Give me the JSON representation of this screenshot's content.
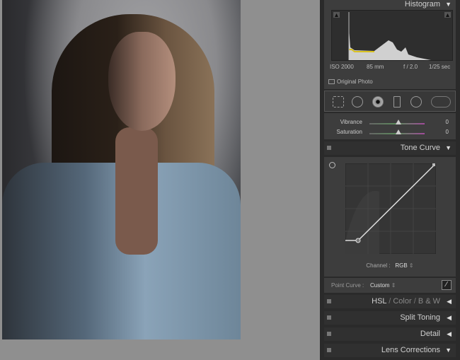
{
  "photo": {
    "description_icon": "portrait-photo"
  },
  "histogram": {
    "title": "Histogram",
    "iso": "ISO 2000",
    "focal": "85 mm",
    "aperture": "f / 2.0",
    "shutter": "1/25 sec",
    "original_photo": "Original Photo"
  },
  "basic": {
    "vibrance_label": "Vibrance",
    "vibrance_value": "0",
    "saturation_label": "Saturation",
    "saturation_value": "0"
  },
  "tone_curve": {
    "title": "Tone Curve",
    "channel_label": "Channel :",
    "channel_value": "RGB",
    "point_curve_label": "Point Curve :",
    "point_curve_value": "Custom"
  },
  "sections": {
    "hsl": "HSL",
    "color": "Color",
    "bw": "B & W",
    "sep": "/",
    "split_toning": "Split Toning",
    "detail": "Detail",
    "lens": "Lens Corrections"
  }
}
